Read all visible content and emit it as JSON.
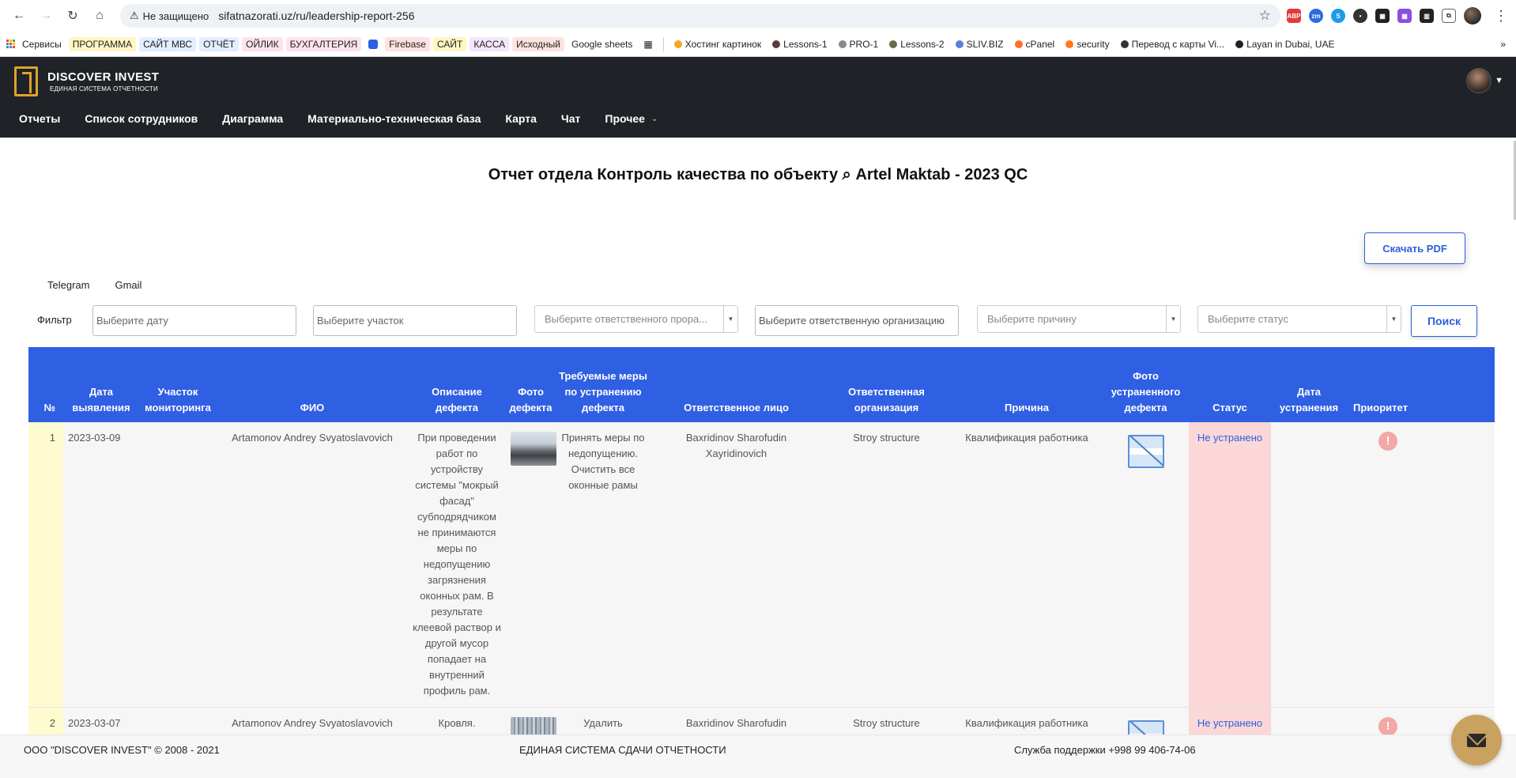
{
  "browser": {
    "security_label": "Не защищено",
    "url": "sifatnazorati.uz/ru/leadership-report-256",
    "bookmarks": [
      {
        "label": "Сервисы",
        "color": "#e8e8e8",
        "bg": ""
      },
      {
        "label": "ПРОГРАММА",
        "color": "#f5e27a",
        "bg": "#fff6c4"
      },
      {
        "label": "САЙТ МВС",
        "color": "#cfe0ff",
        "bg": "#e3eeff"
      },
      {
        "label": "ОТЧЁТ",
        "color": "#cfe0ff",
        "bg": "#e3eeff"
      },
      {
        "label": "ОЙЛИК",
        "color": "#f7c6d9",
        "bg": "#fde3ee"
      },
      {
        "label": "БУХГАЛТЕРИЯ",
        "color": "#f7c6d9",
        "bg": "#fde3ee"
      },
      {
        "label": "",
        "color": "#2b5fde",
        "bg": ""
      },
      {
        "label": "Firebase",
        "color": "#fbd1cd",
        "bg": "#fde3e1"
      },
      {
        "label": "САЙТ",
        "color": "#f5e27a",
        "bg": "#fff6c4"
      },
      {
        "label": "КАССА",
        "color": "#ecd2f5",
        "bg": "#f5e6fb"
      },
      {
        "label": "Исходный",
        "color": "#fbd1cd",
        "bg": "#fde3e1"
      },
      {
        "label": "Google sheets",
        "color": "#e8e8e8",
        "bg": ""
      },
      {
        "label": "Хостинг картинок",
        "color": "#f0a81e",
        "bg": ""
      },
      {
        "label": "Lessons-1",
        "color": "#5a3b3b",
        "bg": ""
      },
      {
        "label": "PRO-1",
        "color": "#888",
        "bg": ""
      },
      {
        "label": "Lessons-2",
        "color": "#6b6b4a",
        "bg": ""
      },
      {
        "label": "SLIV.BIZ",
        "color": "#5a7fd8",
        "bg": ""
      },
      {
        "label": "cPanel",
        "color": "#ff6c2c",
        "bg": ""
      },
      {
        "label": "security",
        "color": "#ff7a1a",
        "bg": ""
      },
      {
        "label": "Перевод с карты Vi...",
        "color": "#333",
        "bg": ""
      },
      {
        "label": "Layan in Dubai, UAE",
        "color": "#222",
        "bg": ""
      }
    ]
  },
  "header": {
    "logo_title": "DISCOVER INVEST",
    "logo_subtitle": "ЕДИНАЯ СИСТЕМА ОТЧЕТНОСТИ",
    "nav": [
      "Отчеты",
      "Список сотрудников",
      "Диаграмма",
      "Материально-техническая база",
      "Карта",
      "Чат",
      "Прочее"
    ]
  },
  "page": {
    "title": "Отчет отдела Контроль качества по объекту ⌕ Artel Maktab - 2023 QC",
    "pdf_button": "Скачать PDF",
    "share": [
      "Telegram",
      "Gmail"
    ]
  },
  "filters": {
    "label": "Фильтр",
    "date_placeholder": "Выберите дату",
    "section_placeholder": "Выберите участок",
    "foreman_placeholder": "Выберите ответственного прора...",
    "org_placeholder": "Выберите ответственную организацию",
    "reason_placeholder": "Выберите причину",
    "status_placeholder": "Выберите статус",
    "search_button": "Поиск"
  },
  "table": {
    "headers": [
      "№",
      "Дата выявления",
      "Участок мониторинга",
      "ФИО",
      "Описание дефекта",
      "Фото дефекта",
      "Требуемые меры по устранению дефекта",
      "Ответственное лицо",
      "Ответственная организация",
      "Причина",
      "Фото устраненного дефекта",
      "Статус",
      "Дата устранения",
      "Приоритет"
    ],
    "rows": [
      {
        "num": "1",
        "date": "2023-03-09",
        "section": "",
        "fio": "Artamonov Andrey Svyatoslavovich",
        "description": "При проведении работ по устройству системы \"мокрый фасад\" субподрядчиком не принимаются меры по недопущению загрязнения оконных рам. В результате клеевой раствор и другой мусор попадает на внутренний профиль рам.",
        "measures": "Принять меры по недопущению. Очистить все оконные рамы",
        "responsible": "Baxridinov Sharofudin Xayridinovich",
        "organization": "Stroy structure",
        "reason": "Квалификация работника",
        "status": "Не устранено",
        "fix_date": ""
      },
      {
        "num": "2",
        "date": "2023-03-07",
        "section": "",
        "fio": "Artamonov Andrey Svyatoslavovich",
        "description": "Кровля. Фасадные работы. Свеженанесенный раствор",
        "measures": "Удалить поврежденный участок штукатурки стен.",
        "responsible": "Baxridinov Sharofudin Xayridinovich",
        "organization": "Stroy structure",
        "reason": "Квалификация работника",
        "status": "Не устранено",
        "fix_date": ""
      }
    ]
  },
  "footer": {
    "copyright": "ООО \"DISCOVER INVEST\" © 2008 - 2021",
    "system": "ЕДИНАЯ СИСТЕМА СДАЧИ ОТЧЕТНОСТИ",
    "support": "Служба поддержки +998 99 406-74-06"
  },
  "colors": {
    "header_bg": "#1f2226",
    "accent": "#2f5fe3",
    "logo": "#e0a22b",
    "status_bg": "#fbd7d7",
    "num_bg": "#fffbd1"
  },
  "icons": [
    "back-icon",
    "forward-icon",
    "reload-icon",
    "home-icon",
    "warning-icon",
    "star-icon",
    "mail-icon",
    "priority-alert-icon",
    "broken-image-icon"
  ]
}
